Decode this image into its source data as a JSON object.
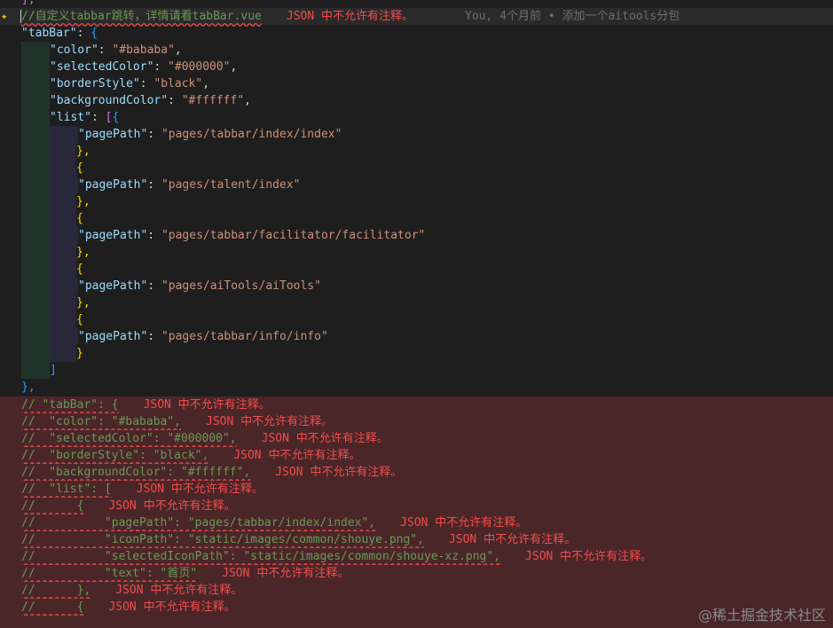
{
  "editor": {
    "line0": "],",
    "line1_comment": "//自定义tabbar跳转，详情请看tabBar.vue",
    "line1_error": "JSON 中不允许有注释。",
    "line1_blame": "You, 4个月前 • 添加一个aitools分包",
    "tabBar_key": "\"tabBar\"",
    "color_key": "\"color\"",
    "color_val": "\"#bababa\"",
    "selectedColor_key": "\"selectedColor\"",
    "selectedColor_val": "\"#000000\"",
    "borderStyle_key": "\"borderStyle\"",
    "borderStyle_val": "\"black\"",
    "backgroundColor_key": "\"backgroundColor\"",
    "backgroundColor_val": "\"#ffffff\"",
    "list_key": "\"list\"",
    "pagePath_key": "\"pagePath\"",
    "pages": [
      "\"pages/tabbar/index/index\"",
      "\"pages/talent/index\"",
      "\"pages/tabbar/facilitator/facilitator\"",
      "\"pages/aiTools/aiTools\"",
      "\"pages/tabbar/info/info\""
    ],
    "commented": [
      {
        "text": "// \"tabBar\": {",
        "err": "JSON 中不允许有注释。"
      },
      {
        "text": "//  \"color\": \"#bababa\",",
        "err": "JSON 中不允许有注释。"
      },
      {
        "text": "//  \"selectedColor\": \"#000000\",",
        "err": "JSON 中不允许有注释。"
      },
      {
        "text": "//  \"borderStyle\": \"black\",",
        "err": "JSON 中不允许有注释。"
      },
      {
        "text": "//  \"backgroundColor\": \"#ffffff\",",
        "err": "JSON 中不允许有注释。"
      },
      {
        "text": "//  \"list\": [",
        "err": "JSON 中不允许有注释。"
      },
      {
        "text": "//      {",
        "err": "JSON 中不允许有注释。"
      },
      {
        "text": "//          \"pagePath\": \"pages/tabbar/index/index\",",
        "err": "JSON 中不允许有注释。"
      },
      {
        "text": "//          \"iconPath\": \"static/images/common/shouye.png\",",
        "err": "JSON 中不允许有注释。"
      },
      {
        "text": "//          \"selectedIconPath\": \"static/images/common/shouye-xz.png\",",
        "err": "JSON 中不允许有注释。"
      },
      {
        "text": "//          \"text\": \"首页\"",
        "err": "JSON 中不允许有注释。"
      },
      {
        "text": "//      },",
        "err": "JSON 中不允许有注释。"
      },
      {
        "text": "//      {",
        "err": "JSON 中不允许有注释。"
      }
    ]
  },
  "watermark": "@稀土掘金技术社区",
  "colors": {
    "background": "#1e1e1e",
    "key": "#9cdcfe",
    "string": "#ce9178",
    "comment": "#6a9955",
    "error": "#f14c4c",
    "error_line_bg": "#4a2628"
  },
  "icons": {
    "gutter": "lightbulb-sparkle-icon"
  }
}
